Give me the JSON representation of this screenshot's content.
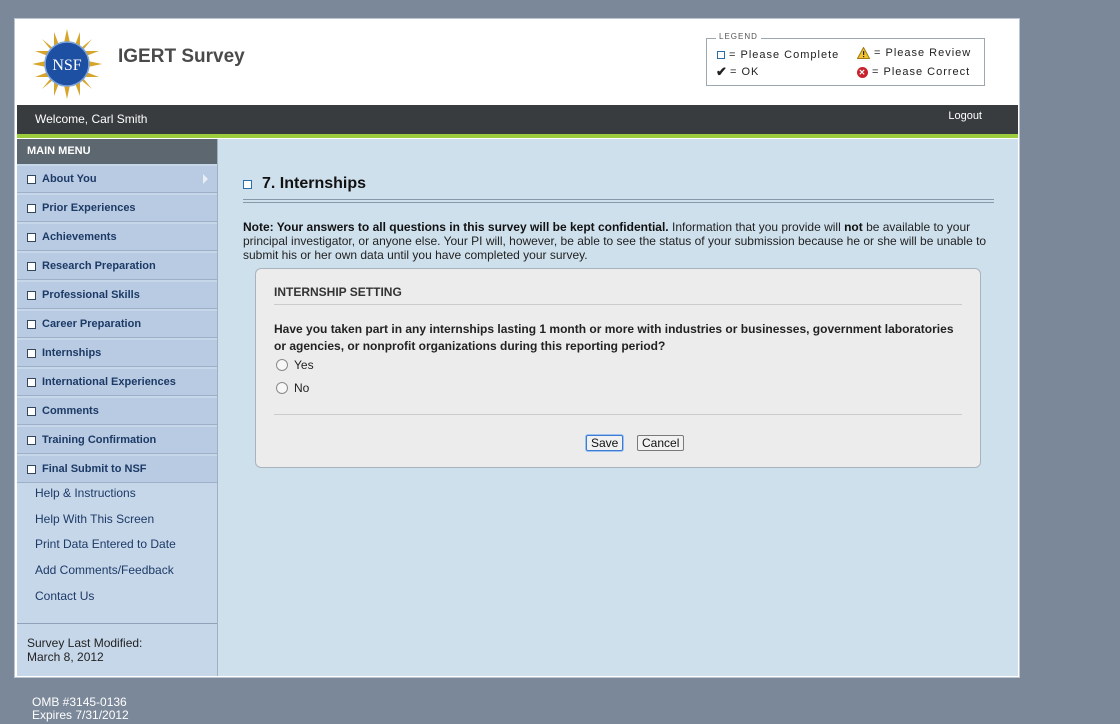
{
  "header": {
    "title": "IGERT Survey",
    "logo_text": "NSF"
  },
  "legend": {
    "title": "LEGEND",
    "items": [
      {
        "icon": "empty-checkbox-icon",
        "label": "= Please Complete"
      },
      {
        "icon": "warning-icon",
        "label": "= Please Review"
      },
      {
        "icon": "checkmark-icon",
        "label": "= OK"
      },
      {
        "icon": "error-icon",
        "label": "= Please Correct"
      }
    ]
  },
  "topbar": {
    "welcome": "Welcome, Carl Smith",
    "logout": "Logout"
  },
  "sidebar": {
    "menu_title": "MAIN MENU",
    "items": [
      {
        "label": "About You"
      },
      {
        "label": "Prior Experiences"
      },
      {
        "label": "Achievements"
      },
      {
        "label": "Research Preparation"
      },
      {
        "label": "Professional Skills"
      },
      {
        "label": "Career Preparation"
      },
      {
        "label": "Internships"
      },
      {
        "label": "International Experiences"
      },
      {
        "label": "Comments"
      },
      {
        "label": "Training Confirmation"
      },
      {
        "label": "Final Submit to NSF"
      }
    ],
    "links": [
      "Help & Instructions",
      "Help With This Screen",
      "Print Data Entered to Date",
      "Add Comments/Feedback",
      "Contact Us"
    ],
    "last_modified_label": "Survey Last Modified:",
    "last_modified_date": "March 8, 2012"
  },
  "main": {
    "title": "7. Internships",
    "note_bold": "Note: Your answers to all questions in this survey will be kept confidential.",
    "note_part1": " Information that you provide will ",
    "note_not": "not",
    "note_part2": " be available to your principal investigator, or anyone else. Your PI will, however, be able to see the status of your submission because he or she will be unable to submit his or her own data until you have completed your survey.",
    "section_title": "INTERNSHIP SETTING",
    "question": "Have you taken part in any internships lasting 1 month or more with industries or businesses, government laboratories or agencies, or nonprofit organizations during this reporting period?",
    "options": [
      "Yes",
      "No"
    ],
    "save_label": "Save",
    "cancel_label": "Cancel"
  },
  "footer": {
    "omb": "OMB #3145-0136",
    "expires": "Expires 7/31/2012"
  },
  "colors": {
    "page_bg": "#7b8899",
    "topbar": "#383c3f",
    "accent_green": "#9ccd3c",
    "sidebar": "#c7d7ea",
    "main_bg": "#cfe0ed"
  }
}
